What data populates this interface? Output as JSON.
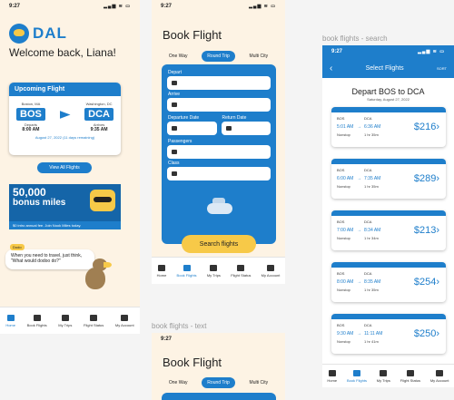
{
  "labels": {
    "search": "book flights - search",
    "text": "book flights - text"
  },
  "home": {
    "time": "9:27",
    "status_icons": "▂▄▆ ≋ ▭",
    "logo": "DAL",
    "welcome": "Welcome back, Liana!",
    "upcoming": {
      "title": "Upcoming Flight",
      "from": {
        "city": "Boston, MA",
        "code": "BOS",
        "label": "Departs",
        "time": "8:00 AM"
      },
      "to": {
        "city": "Washington, DC",
        "code": "DCA",
        "label": "Arrives",
        "time": "9:35 AM"
      },
      "date": "August 27, 2022 (11 days remaining)"
    },
    "view_all": "View All Flights",
    "promo": {
      "big": "50,000",
      "mid": "bonus miles",
      "small": "$0 intro annual fee. Join Nook Miles today."
    },
    "tag": "Dodo",
    "speech": "When you need to travel, just think, \"What would dodoo do?\""
  },
  "tabs": [
    {
      "label": "Home"
    },
    {
      "label": "Book Flights"
    },
    {
      "label": "My Trips"
    },
    {
      "label": "Flight Status"
    },
    {
      "label": "My Account"
    }
  ],
  "book": {
    "time": "9:27",
    "status_icons": "▂▄▆ ≋ ▭",
    "title": "Book Flight",
    "segments": [
      "One Way",
      "Round Trip",
      "Multi City"
    ],
    "fields": {
      "depart": "Depart",
      "arrive": "Arrive",
      "departure_date": "Departure Date",
      "return_date": "Return Date",
      "passengers": "Passengers",
      "class": "Class"
    },
    "search_button": "Search flights"
  },
  "select": {
    "time": "9:27",
    "status_icons": "▂▄▆ ≋ ▭",
    "back": "‹",
    "title": "Select Flights",
    "sort": "SORT",
    "depart_title": "Depart BOS to DCA",
    "depart_date": "Saturday, August 27, 2022",
    "flights": [
      {
        "from": "BOS",
        "to": "DCA",
        "dep": "5:01 AM",
        "arr": "6:36 AM",
        "stops": "Nonstop",
        "dur": "1 hr 35m",
        "price": "$216"
      },
      {
        "from": "BOS",
        "to": "DCA",
        "dep": "6:00 AM",
        "arr": "7:35 AM",
        "stops": "Nonstop",
        "dur": "1 hr 35m",
        "price": "$289"
      },
      {
        "from": "BOS",
        "to": "DCA",
        "dep": "7:00 AM",
        "arr": "8:34 AM",
        "stops": "Nonstop",
        "dur": "1 hr 34m",
        "price": "$213"
      },
      {
        "from": "BOS",
        "to": "DCA",
        "dep": "8:00 AM",
        "arr": "8:35 AM",
        "stops": "Nonstop",
        "dur": "1 hr 35m",
        "price": "$254"
      },
      {
        "from": "BOS",
        "to": "DCA",
        "dep": "9:30 AM",
        "arr": "11:11 AM",
        "stops": "Nonstop",
        "dur": "1 hr 41m",
        "price": "$250"
      }
    ],
    "arrow": "›"
  },
  "partial": {
    "time": "9:27",
    "title": "Book Flight",
    "segments": [
      "One Way",
      "Round Trip",
      "Multi City"
    ]
  },
  "colors": {
    "primary": "#1e7ecb",
    "accent": "#f7c948",
    "background": "#fdf3e4"
  }
}
